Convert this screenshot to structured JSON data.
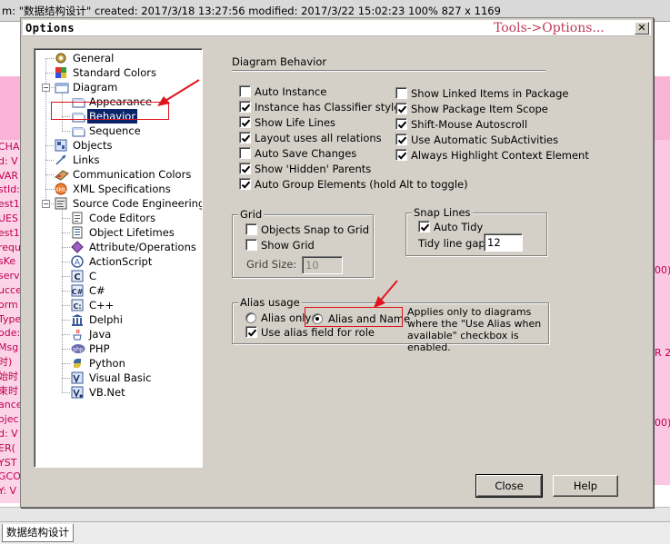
{
  "background": {
    "header_text": "m: \"数据结构设计\" created: 2017/3/18 13:27:56 modified: 2017/3/22 15:02:23   100%   827 x 1169",
    "left_fragments": [
      "CHA",
      "d: V",
      "VAR",
      "stId:",
      "est1",
      "UES",
      "est1",
      "requ",
      "sKe",
      "servi",
      "ucce",
      "orm",
      "Type",
      "ode:",
      "Msg",
      "时)",
      "始时",
      "束时",
      "ance",
      "ojec",
      "d: V",
      "ER(",
      "YST",
      "GCO",
      "Y: V"
    ],
    "right_fragments": [
      "00)",
      "R 20",
      "00)"
    ],
    "tab_label": "数据结构设计"
  },
  "dialog": {
    "title": "Options",
    "watermark": "Tools->Options...",
    "close_glyph": "✕"
  },
  "tree": [
    {
      "label": "General",
      "icon": "general-icon",
      "level": 0
    },
    {
      "label": "Standard Colors",
      "icon": "colors-icon",
      "level": 0
    },
    {
      "label": "Diagram",
      "icon": "diagram-folder-icon",
      "level": 0,
      "expander": "−"
    },
    {
      "label": "Appearance",
      "icon": "page-icon",
      "level": 1
    },
    {
      "label": "Behavior",
      "icon": "page-icon",
      "level": 1,
      "selected": true
    },
    {
      "label": "Sequence",
      "icon": "page-icon",
      "level": 1
    },
    {
      "label": "Objects",
      "icon": "objects-icon",
      "level": 0
    },
    {
      "label": "Links",
      "icon": "links-icon",
      "level": 0
    },
    {
      "label": "Communication Colors",
      "icon": "comm-colors-icon",
      "level": 0
    },
    {
      "label": "XML Specifications",
      "icon": "xml-icon",
      "level": 0
    },
    {
      "label": "Source Code Engineering",
      "icon": "source-code-icon",
      "level": 0,
      "expander": "−"
    },
    {
      "label": "Code Editors",
      "icon": "code-editors-icon",
      "level": 1
    },
    {
      "label": "Object Lifetimes",
      "icon": "lifetimes-icon",
      "level": 1
    },
    {
      "label": "Attribute/Operations",
      "icon": "attr-ops-icon",
      "level": 1
    },
    {
      "label": "ActionScript",
      "icon": "actionscript-icon",
      "level": 1
    },
    {
      "label": "C",
      "icon": "c-icon",
      "level": 1
    },
    {
      "label": "C#",
      "icon": "csharp-icon",
      "level": 1
    },
    {
      "label": "C++",
      "icon": "cpp-icon",
      "level": 1
    },
    {
      "label": "Delphi",
      "icon": "delphi-icon",
      "level": 1
    },
    {
      "label": "Java",
      "icon": "java-icon",
      "level": 1
    },
    {
      "label": "PHP",
      "icon": "php-icon",
      "level": 1
    },
    {
      "label": "Python",
      "icon": "python-icon",
      "level": 1
    },
    {
      "label": "Visual Basic",
      "icon": "vb-icon",
      "level": 1
    },
    {
      "label": "VB.Net",
      "icon": "vbnet-icon",
      "level": 1
    }
  ],
  "diagram_behavior": {
    "section_title": "Diagram Behavior",
    "left_options": [
      {
        "label": "Auto Instance",
        "checked": false
      },
      {
        "label": "Instance has Classifier style",
        "checked": true
      },
      {
        "label": "Show Life Lines",
        "checked": true
      },
      {
        "label": "Layout uses all relations",
        "checked": true
      },
      {
        "label": "Auto Save Changes",
        "checked": false
      },
      {
        "label": "Show 'Hidden' Parents",
        "checked": true
      },
      {
        "label": "Auto Group Elements (hold Alt to toggle)",
        "checked": true
      }
    ],
    "right_options": [
      {
        "label": "Show Linked Items in Package",
        "checked": false
      },
      {
        "label": "Show Package Item Scope",
        "checked": true
      },
      {
        "label": "Shift-Mouse Autoscroll",
        "checked": true
      },
      {
        "label": "Use Automatic SubActivities",
        "checked": true
      },
      {
        "label": "Always Highlight Context Element",
        "checked": true
      }
    ]
  },
  "grid": {
    "title": "Grid",
    "snap_label": "Objects Snap to Grid",
    "snap_checked": false,
    "show_label": "Show Grid",
    "show_checked": false,
    "size_label": "Grid Size:",
    "size_value": "10"
  },
  "snap_lines": {
    "title": "Snap Lines",
    "auto_tidy_label": "Auto Tidy",
    "auto_tidy_checked": true,
    "gap_label": "Tidy line gap:",
    "gap_value": "12"
  },
  "alias": {
    "title": "Alias usage",
    "alias_only_label": "Alias only",
    "alias_name_label": "Alias and Name",
    "selected": "alias_and_name",
    "role_label": "Use alias field for role",
    "role_checked": true,
    "note": "Applies only to diagrams where the \"Use Alias when available\" checkbox is enabled."
  },
  "buttons": {
    "close": "Close",
    "help": "Help"
  },
  "colors": {
    "highlight": "#0a246a",
    "annotation": "#e0141e",
    "background_pink": "#f9b3d6"
  }
}
